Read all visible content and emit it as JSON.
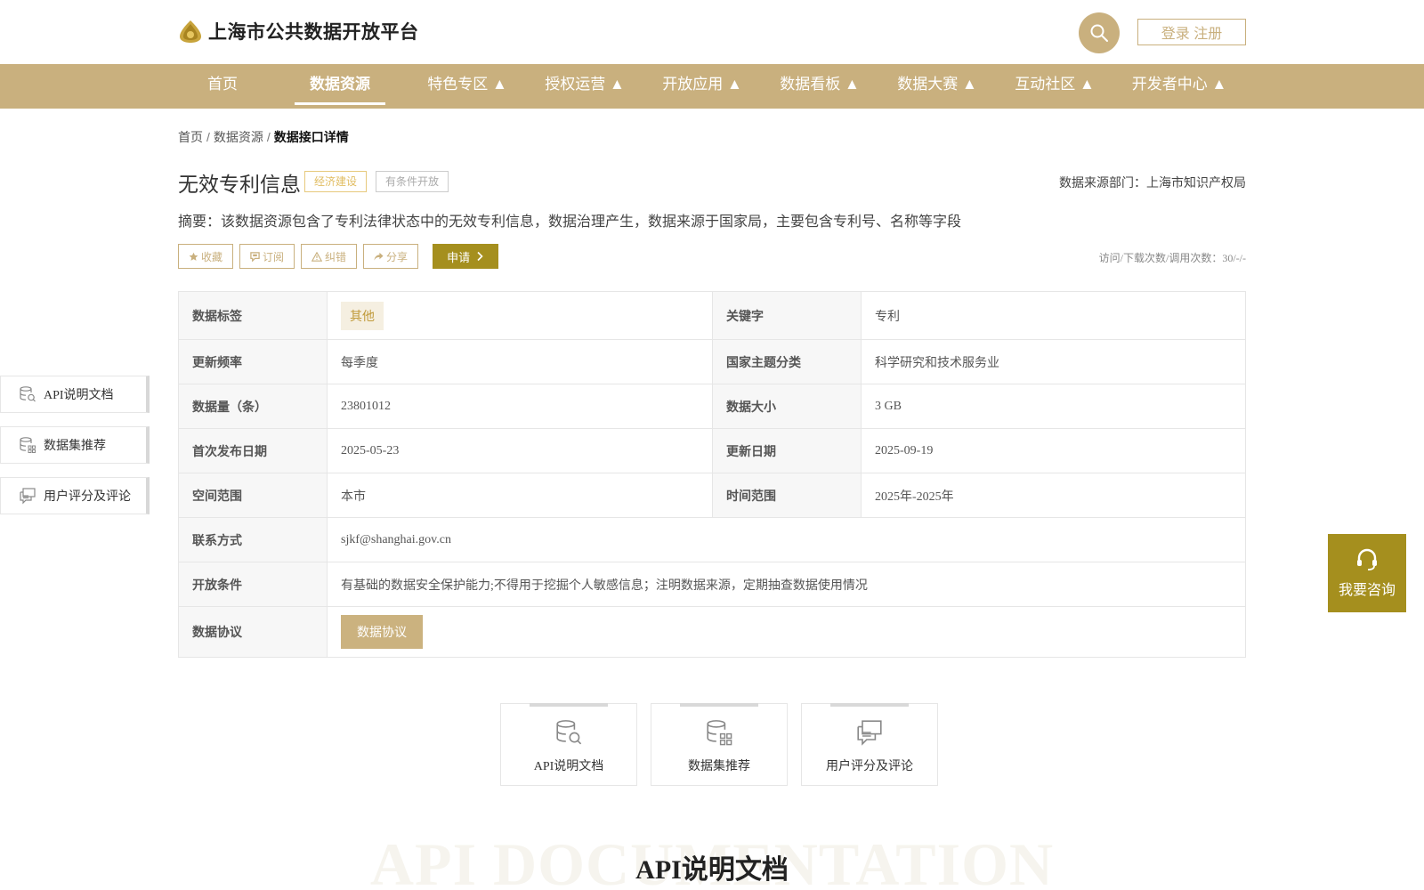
{
  "header": {
    "site_title": "上海市公共数据开放平台",
    "login_label": "登录 注册",
    "accent_color": "#c9b07e"
  },
  "nav": {
    "items": [
      {
        "label": "首页"
      },
      {
        "label": "数据资源"
      },
      {
        "label": "特色专区 ▲"
      },
      {
        "label": "授权运营 ▲"
      },
      {
        "label": "开放应用 ▲"
      },
      {
        "label": "数据看板 ▲"
      },
      {
        "label": "数据大赛 ▲"
      },
      {
        "label": "互动社区 ▲"
      },
      {
        "label": "开发者中心 ▲"
      }
    ],
    "active_index": 1
  },
  "breadcrumb": {
    "home": "首页",
    "level1": "数据资源",
    "current": "数据接口详情",
    "sep": "/"
  },
  "dataset": {
    "title": "无效专利信息",
    "tag_category": "经济建设",
    "tag_open": "有条件开放",
    "source_dept": "数据来源部门：上海市知识产权局",
    "summary": "摘要：该数据资源包含了专利法律状态中的无效专利信息，数据治理产生，数据来源于国家局，主要包含专利号、名称等字段",
    "visits": "访问/下载次数/调用次数：30/-/-"
  },
  "actions": {
    "favorite": "收藏",
    "subscribe": "订阅",
    "report": "纠错",
    "share": "分享",
    "apply": "申请"
  },
  "info": {
    "tag_key": "数据标签",
    "tag_value": "其他",
    "keyword_key": "关键字",
    "keyword_value": "专利",
    "freq_key": "更新频率",
    "freq_value": "每季度",
    "theme_key": "国家主题分类",
    "theme_value": "科学研究和技术服务业",
    "count_key": "数据量（条）",
    "count_value": "23801012",
    "size_key": "数据大小",
    "size_value": "3 GB",
    "first_key": "首次发布日期",
    "first_value": "2025-05-23",
    "update_key": "更新日期",
    "update_value": "2025-09-19",
    "space_key": "空间范围",
    "space_value": "本市",
    "time_key": "时间范围",
    "time_value": "2025年-2025年",
    "contact_key": "联系方式",
    "contact_value": "sjkf@shanghai.gov.cn",
    "condition_key": "开放条件",
    "condition_value": "有基础的数据安全保护能力;不得用于挖掘个人敏感信息；注明数据来源，定期抽查数据使用情况",
    "protocol_key": "数据协议",
    "protocol_button": "数据协议"
  },
  "side_nav": {
    "api_doc": "API说明文档",
    "recommend": "数据集推荐",
    "reviews": "用户评分及评论"
  },
  "consult": {
    "label": "我要咨询"
  },
  "cards": {
    "api_doc": "API说明文档",
    "recommend": "数据集推荐",
    "reviews": "用户评分及评论"
  },
  "section": {
    "bg_word": "API DOCUMENTATION",
    "title": "API说明文档"
  }
}
